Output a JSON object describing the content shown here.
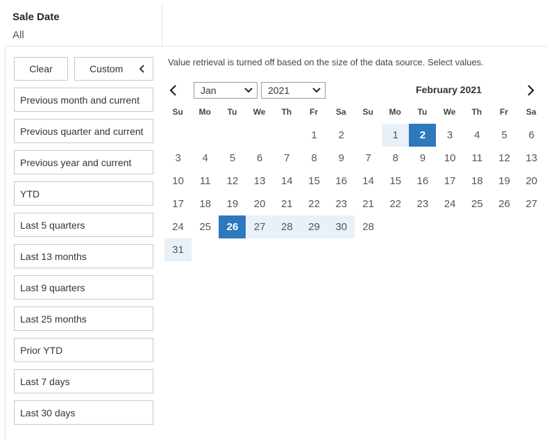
{
  "filter": {
    "title": "Sale Date",
    "value": "All"
  },
  "buttons": {
    "clear": "Clear",
    "custom": "Custom"
  },
  "presets": [
    "Previous month and current",
    "Previous quarter and current",
    "Previous year and current",
    "YTD",
    "Last 5 quarters",
    "Last 13 months",
    "Last 9 quarters",
    "Last 25 months",
    "Prior YTD",
    "Last 7 days",
    "Last 30 days"
  ],
  "message": "Value retrieval is turned off based on the size of the data source. Select values.",
  "calendar": {
    "month_select": "Jan",
    "year_select": "2021",
    "second_month_label": "February 2021",
    "weekdays": [
      "Su",
      "Mo",
      "Tu",
      "We",
      "Th",
      "Fr",
      "Sa"
    ],
    "months": [
      {
        "name": "January 2021",
        "weeks": [
          [
            "",
            "",
            "",
            "",
            "",
            "1",
            "2"
          ],
          [
            "3",
            "4",
            "5",
            "6",
            "7",
            "8",
            "9"
          ],
          [
            "10",
            "11",
            "12",
            "13",
            "14",
            "15",
            "16"
          ],
          [
            "17",
            "18",
            "19",
            "20",
            "21",
            "22",
            "23"
          ],
          [
            "24",
            "25",
            "26",
            "27",
            "28",
            "29",
            "30"
          ],
          [
            "31",
            "",
            "",
            "",
            "",
            "",
            ""
          ]
        ]
      },
      {
        "name": "February 2021",
        "weeks": [
          [
            "",
            "1",
            "2",
            "3",
            "4",
            "5",
            "6"
          ],
          [
            "7",
            "8",
            "9",
            "10",
            "11",
            "12",
            "13"
          ],
          [
            "14",
            "15",
            "16",
            "17",
            "18",
            "19",
            "20"
          ],
          [
            "21",
            "22",
            "23",
            "24",
            "25",
            "26",
            "27"
          ],
          [
            "28",
            "",
            "",
            "",
            "",
            "",
            ""
          ]
        ]
      }
    ],
    "range_start": {
      "month": 0,
      "day": "26"
    },
    "range_end": {
      "month": 1,
      "day": "2"
    },
    "colors": {
      "selected": "#2e78bd",
      "in_range": "#e8f1f8"
    }
  }
}
